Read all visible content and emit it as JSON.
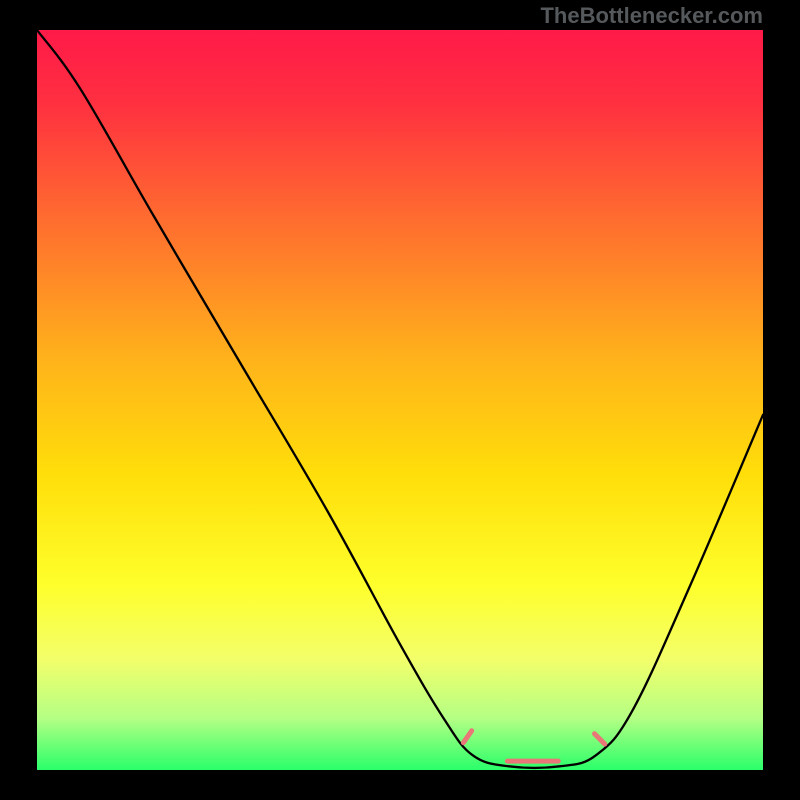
{
  "attribution": "TheBottlenecker.com",
  "chart_data": {
    "type": "line",
    "title": "",
    "xlabel": "",
    "ylabel": "",
    "xlim": [
      0,
      100
    ],
    "ylim": [
      0,
      100
    ],
    "legend": false,
    "background": {
      "type": "vertical-gradient",
      "stops": [
        {
          "offset": 0.0,
          "color": "#ff1a49"
        },
        {
          "offset": 0.1,
          "color": "#ff3040"
        },
        {
          "offset": 0.25,
          "color": "#ff6a30"
        },
        {
          "offset": 0.45,
          "color": "#ffb41a"
        },
        {
          "offset": 0.6,
          "color": "#ffde0a"
        },
        {
          "offset": 0.75,
          "color": "#feff2b"
        },
        {
          "offset": 0.85,
          "color": "#f3ff6a"
        },
        {
          "offset": 0.93,
          "color": "#b4ff84"
        },
        {
          "offset": 1.0,
          "color": "#2aff6a"
        }
      ]
    },
    "series": [
      {
        "name": "curve",
        "type": "line",
        "color": "#000000",
        "points": [
          {
            "x": 0,
            "y": 100
          },
          {
            "x": 6,
            "y": 92
          },
          {
            "x": 16,
            "y": 75
          },
          {
            "x": 28,
            "y": 55
          },
          {
            "x": 40,
            "y": 35
          },
          {
            "x": 50,
            "y": 17
          },
          {
            "x": 56,
            "y": 7
          },
          {
            "x": 60,
            "y": 2
          },
          {
            "x": 65,
            "y": 0.5
          },
          {
            "x": 72,
            "y": 0.5
          },
          {
            "x": 77,
            "y": 2
          },
          {
            "x": 82,
            "y": 8
          },
          {
            "x": 90,
            "y": 25
          },
          {
            "x": 100,
            "y": 48
          }
        ]
      },
      {
        "name": "marker-left",
        "type": "marker",
        "shape": "capsule",
        "color": "#e97777",
        "center": {
          "x": 59.3,
          "y": 4.5
        },
        "length": 2.0,
        "thickness": 5,
        "angle_deg": -55
      },
      {
        "name": "marker-center",
        "type": "marker",
        "shape": "capsule",
        "color": "#e97777",
        "center": {
          "x": 68.3,
          "y": 1.2
        },
        "length": 7.0,
        "thickness": 5,
        "angle_deg": 0
      },
      {
        "name": "marker-right",
        "type": "marker",
        "shape": "capsule",
        "color": "#e97777",
        "center": {
          "x": 77.5,
          "y": 4.2
        },
        "length": 2.0,
        "thickness": 5,
        "angle_deg": 45
      }
    ]
  }
}
